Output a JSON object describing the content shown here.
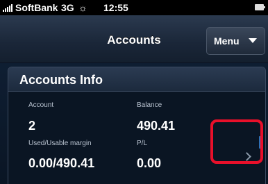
{
  "status_bar": {
    "carrier": "SoftBank",
    "network": "3G",
    "time": "12:55",
    "icons": [
      "signal-icon",
      "activity-icon",
      "battery-icon"
    ]
  },
  "nav": {
    "title": "Accounts",
    "menu_label": "Menu"
  },
  "panel": {
    "title": "Accounts Info",
    "fields": {
      "account_label": "Account",
      "account_value": "2",
      "balance_label": "Balance",
      "balance_value": "490.41",
      "margin_label": "Used/Usable margin",
      "margin_value": "0.00/490.41",
      "pl_label": "P/L",
      "pl_value": "0.00"
    }
  },
  "colors": {
    "highlight": "#e8102a",
    "background": "#0d1a2a",
    "accent": "#2f6fb3"
  }
}
